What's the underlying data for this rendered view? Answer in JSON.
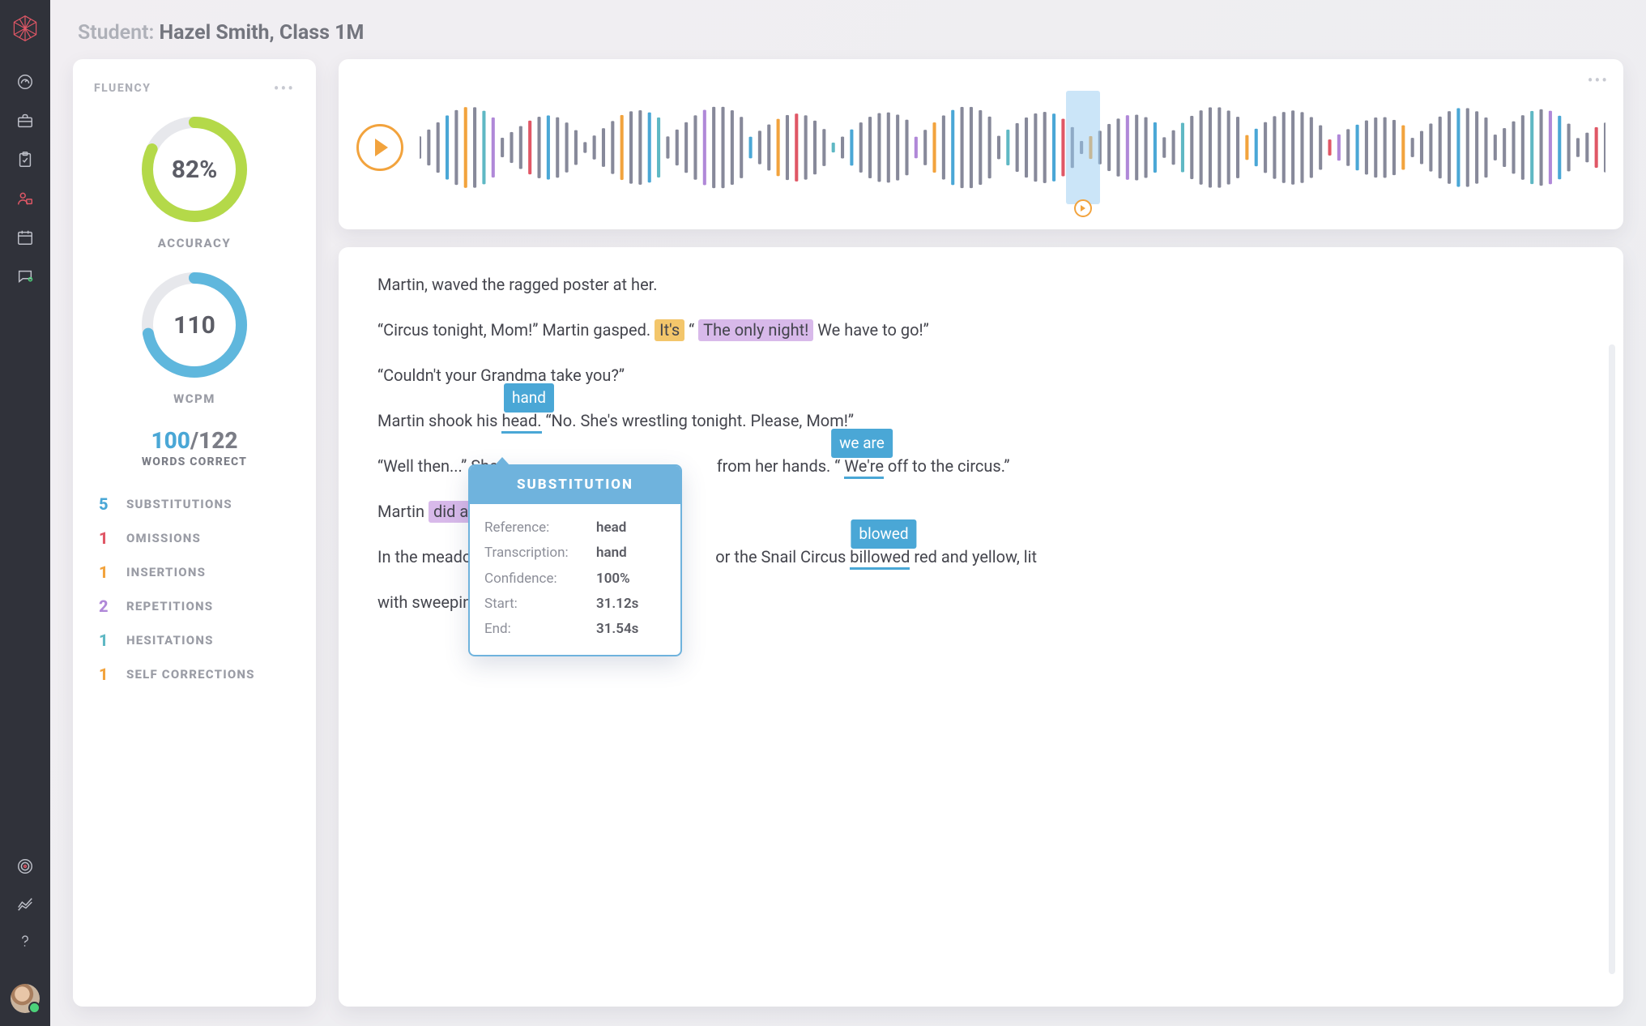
{
  "header": {
    "prefix": "Student:",
    "value": "Hazel Smith, Class 1M"
  },
  "fluency": {
    "title": "FLUENCY",
    "accuracy": {
      "value": "82%",
      "label": "ACCURACY",
      "pct": 82,
      "color": "#b4d949"
    },
    "wcpm": {
      "value": "110",
      "label": "WCPM",
      "pct": 72,
      "color": "#5fb7dd"
    },
    "words_correct": {
      "correct": "100",
      "sep": "/",
      "total": "122",
      "label": "WORDS CORRECT"
    },
    "errors": [
      {
        "count": "5",
        "label": "SUBSTITUTIONS",
        "colorClass": "c-blue"
      },
      {
        "count": "1",
        "label": "OMISSIONS",
        "colorClass": "c-red"
      },
      {
        "count": "1",
        "label": "INSERTIONS",
        "colorClass": "c-orange"
      },
      {
        "count": "2",
        "label": "REPETITIONS",
        "colorClass": "c-purple"
      },
      {
        "count": "1",
        "label": "HESITATIONS",
        "colorClass": "c-teal"
      },
      {
        "count": "1",
        "label": "SELF CORRECTIONS",
        "colorClass": "c-orange"
      }
    ]
  },
  "passage": {
    "p1": "Martin, waved the ragged poster at her.",
    "p2a": "“Circus tonight, Mom!” Martin gasped. ",
    "p2_hl1": "It's",
    "p2b": " “ ",
    "p2_hl2": "The only night!",
    "p2c": "  We have to go!”",
    "p3": "“Couldn't your Grandma take you?”",
    "p4a": "Martin shook his  ",
    "p4_head": "head.",
    "p4b": "  “No. She's wrestling tonight. Please, Mom!”",
    "annot_hand": "hand",
    "p5a": "“Well then...” She",
    "p5b": "from her hands. “ ",
    "p5_were": "We're",
    "p5c": "  off to the circus.”",
    "annot_weare": "we are",
    "p6a": "Martin ",
    "p6_hl": "did  a ha",
    "p6b": "p",
    "p7a": "In the meadow n",
    "p7b": "or the Snail Circus  ",
    "p7_billowed": "billowed",
    "p7c": "  red and yellow, lit",
    "annot_blowed": "blowed",
    "p8": "with sweeping lights."
  },
  "popover": {
    "title": "SUBSTITUTION",
    "rows": [
      {
        "k": "Reference:",
        "v": "head"
      },
      {
        "k": "Transcription:",
        "v": "hand"
      },
      {
        "k": "Confidence:",
        "v": "100%"
      },
      {
        "k": "Start:",
        "v": "31.12s"
      },
      {
        "k": "End:",
        "v": "31.54s"
      }
    ]
  },
  "colors": {
    "orange": "#f2a33d",
    "blue": "#4aa7d6",
    "purple": "#b088d8",
    "red": "#e05766",
    "teal": "#5fb8c4",
    "grey": "#87899a"
  }
}
